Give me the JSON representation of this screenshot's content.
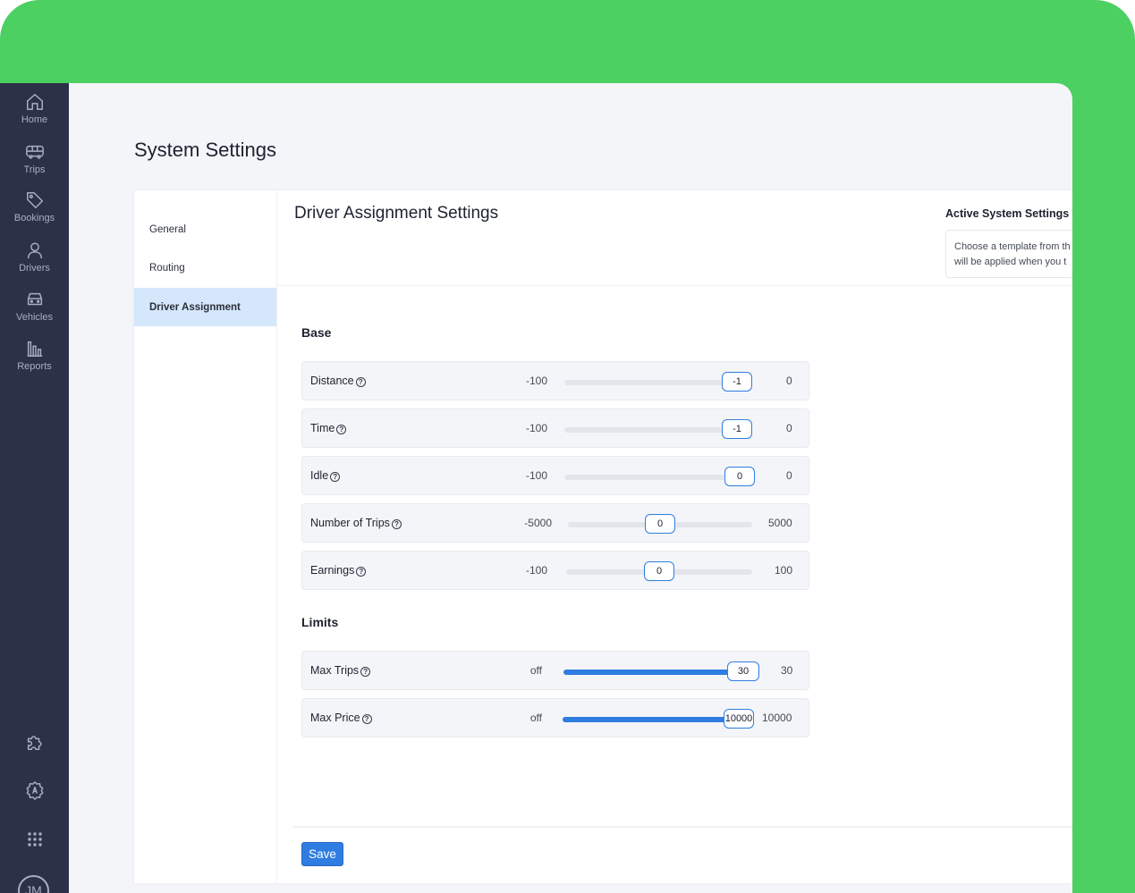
{
  "nav": {
    "items": [
      {
        "label": "Home",
        "icon": "home-icon"
      },
      {
        "label": "Trips",
        "icon": "bus-icon"
      },
      {
        "label": "Bookings",
        "icon": "tag-icon"
      },
      {
        "label": "Drivers",
        "icon": "user-icon"
      },
      {
        "label": "Vehicles",
        "icon": "car-icon"
      },
      {
        "label": "Reports",
        "icon": "bar-chart-icon"
      }
    ],
    "bottom_icons": [
      "puzzle-icon",
      "gear-icon",
      "grid-icon"
    ],
    "avatar_initials": "JM"
  },
  "page": {
    "title": "System Settings"
  },
  "subnav": {
    "items": [
      {
        "label": "General"
      },
      {
        "label": "Routing"
      },
      {
        "label": "Driver Assignment",
        "active": true
      }
    ]
  },
  "main": {
    "title": "Driver Assignment Settings",
    "template": {
      "title": "Active System Settings T",
      "line1": "Choose a template from th",
      "line2": "will be applied when you t"
    },
    "base": {
      "title": "Base",
      "sliders": [
        {
          "label": "Distance",
          "min": "-100",
          "max": "0",
          "value": "-1",
          "fraction": 0.99
        },
        {
          "label": "Time",
          "min": "-100",
          "max": "0",
          "value": "-1",
          "fraction": 0.99
        },
        {
          "label": "Idle",
          "min": "-100",
          "max": "0",
          "value": "0",
          "fraction": 1.0
        },
        {
          "label": "Number of Trips",
          "min": "-5000",
          "max": "5000",
          "value": "0",
          "fraction": 0.5
        },
        {
          "label": "Earnings",
          "min": "-100",
          "max": "100",
          "value": "0",
          "fraction": 0.5
        }
      ]
    },
    "limits": {
      "title": "Limits",
      "sliders": [
        {
          "label": "Max Trips",
          "min": "off",
          "max": "30",
          "value": "30",
          "fraction": 1.0
        },
        {
          "label": "Max Price",
          "min": "off",
          "max": "10000",
          "value": "10000",
          "fraction": 1.0
        }
      ]
    },
    "save_label": "Save"
  },
  "colors": {
    "accent": "#2f7de1",
    "sidebar": "#2c3148",
    "frame_bg": "#4cd062",
    "active_subnav": "#d5e7fb"
  }
}
